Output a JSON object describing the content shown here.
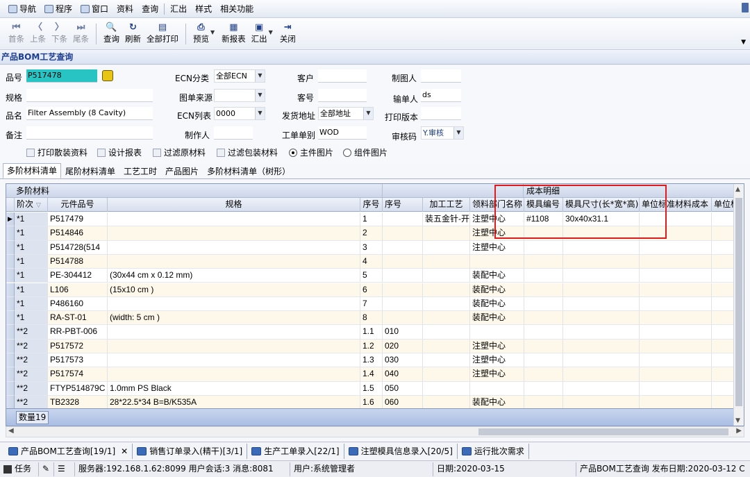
{
  "menu": {
    "items": [
      "导航",
      "程序",
      "窗口",
      "资料",
      "查询",
      "汇出",
      "样式",
      "相关功能"
    ]
  },
  "toolbar": {
    "buttons": [
      {
        "icon": "first-icon",
        "glyph": "⏮",
        "label": "首条"
      },
      {
        "icon": "prev-icon",
        "glyph": "〈",
        "label": "上条"
      },
      {
        "icon": "next-icon",
        "glyph": "〉",
        "label": "下条"
      },
      {
        "icon": "last-icon",
        "glyph": "⏭",
        "label": "尾条"
      },
      {
        "icon": "query-icon",
        "glyph": "🔍",
        "label": "查询"
      },
      {
        "icon": "refresh-icon",
        "glyph": "↻",
        "label": "刷新"
      },
      {
        "icon": "print-all-icon",
        "glyph": "▤",
        "label": "全部打印"
      },
      {
        "icon": "preview-icon",
        "glyph": "⎙",
        "label": "预览"
      },
      {
        "icon": "new-report-icon",
        "glyph": "▦",
        "label": "新报表"
      },
      {
        "icon": "export-icon",
        "glyph": "▣",
        "label": "汇出"
      },
      {
        "icon": "close-icon",
        "glyph": "⇥",
        "label": "关闭"
      }
    ]
  },
  "page_title": "产品BOM工艺查询",
  "form": {
    "item_no_label": "品号",
    "item_no": "P517478",
    "spec_label": "规格",
    "spec": "",
    "name_label": "品名",
    "name": "Filter Assembly (8 Cavity)",
    "remark_label": "备注",
    "remark": "",
    "ecn_type_label": "ECN分类",
    "ecn_type": "全部ECN",
    "doc_source_label": "图单来源",
    "doc_source": "",
    "ecn_list_label": "ECN列表",
    "ecn_list": "0000",
    "maker_label": "制作人",
    "maker": "",
    "customer_label": "客户",
    "customer": "",
    "customer_no_label": "客号",
    "customer_no": "",
    "ship_addr_label": "发货地址",
    "ship_addr": "全部地址",
    "work_order_type_label": "工单单别",
    "work_order_type": "WOD",
    "drawer_label": "制图人",
    "drawer": "",
    "input_by_label": "输单人",
    "input_by": "ds",
    "print_version_label": "打印版本",
    "print_version": "",
    "audit_code_label": "审核码",
    "audit_code": "Y.审核",
    "checks": [
      "打印散装资料",
      "设计报表",
      "过滤原材料",
      "过滤包装材料"
    ],
    "radios": [
      "主件图片",
      "组件图片"
    ]
  },
  "tabs": [
    "多阶材料清单",
    "尾阶材料清单",
    "工艺工时",
    "产品图片",
    "多阶材料清单（树形）"
  ],
  "grid": {
    "group_left": "多阶材料",
    "group_cost": "成本明细",
    "headers": [
      "阶次",
      "元件品号",
      "规格",
      "序号",
      "序号",
      "加工工艺",
      "领料部门名称",
      "模具编号",
      "模具尺寸(长*宽*高)",
      "单位标准材料成本",
      "单位标"
    ],
    "rows": [
      [
        "*1",
        "P517479",
        "",
        "1",
        "",
        "装五金针-开",
        "注塑中心",
        "#1108",
        "30x40x31.1",
        "",
        ""
      ],
      [
        "*1",
        "P514846",
        "",
        "2",
        "",
        "",
        "注塑中心",
        "",
        "",
        "",
        ""
      ],
      [
        "*1",
        "P514728(514",
        "",
        "3",
        "",
        "",
        "注塑中心",
        "",
        "",
        "",
        ""
      ],
      [
        "*1",
        "P514788",
        "",
        "4",
        "",
        "",
        "",
        "",
        "",
        "",
        ""
      ],
      [
        "*1",
        "PE-304412",
        "(30x44 cm x 0.12 mm)",
        "5",
        "",
        "",
        "装配中心",
        "",
        "",
        "",
        ""
      ],
      [
        "*1",
        "L106",
        "(15x10 cm )",
        "6",
        "",
        "",
        "装配中心",
        "",
        "",
        "",
        ""
      ],
      [
        "*1",
        "P486160",
        "",
        "7",
        "",
        "",
        "装配中心",
        "",
        "",
        "",
        ""
      ],
      [
        "*1",
        "RA-ST-01",
        "(width: 5 cm )",
        "8",
        "",
        "",
        "装配中心",
        "",
        "",
        "",
        ""
      ],
      [
        "**2",
        "RR-PBT-006",
        "",
        "1.1",
        "010",
        "",
        "",
        "",
        "",
        "",
        ""
      ],
      [
        "**2",
        "P517572",
        "",
        "1.2",
        "020",
        "",
        "注塑中心",
        "",
        "",
        "",
        ""
      ],
      [
        "**2",
        "P517573",
        "",
        "1.3",
        "030",
        "",
        "注塑中心",
        "",
        "",
        "",
        ""
      ],
      [
        "**2",
        "P517574",
        "",
        "1.4",
        "040",
        "",
        "注塑中心",
        "",
        "",
        "",
        ""
      ],
      [
        "**2",
        "FTYP514879C",
        "1.0mm PS Black",
        "1.5",
        "050",
        "",
        "",
        "",
        "",
        "",
        ""
      ],
      [
        "**2",
        "TB2328",
        "28*22.5*34 B=B/K535A",
        "1.6",
        "060",
        "",
        "装配中心",
        "",
        "",
        "",
        ""
      ]
    ],
    "footer_count": "数量19"
  },
  "window_tabs": [
    {
      "label": "产品BOM工艺查询[19/1]",
      "closable": true
    },
    {
      "label": "销售订单录入(精干)[3/1]",
      "closable": false
    },
    {
      "label": "生产工单录入[22/1]",
      "closable": false
    },
    {
      "label": "注塑模具信息录入[20/5]",
      "closable": false
    },
    {
      "label": "运行批次需求",
      "closable": false
    }
  ],
  "status": {
    "task": "任务",
    "server": "服务器:192.168.1.62:8099 用户会话:3 消息:8081",
    "user": "用户:系统管理者",
    "date": "日期:2020-03-15",
    "release": "产品BOM工艺查询 发布日期:2020-03-12 C"
  },
  "colors": {
    "highlight_box": "#e0191c",
    "title_blue": "#1b3d92",
    "item_no_bg": "#28c4c4"
  }
}
